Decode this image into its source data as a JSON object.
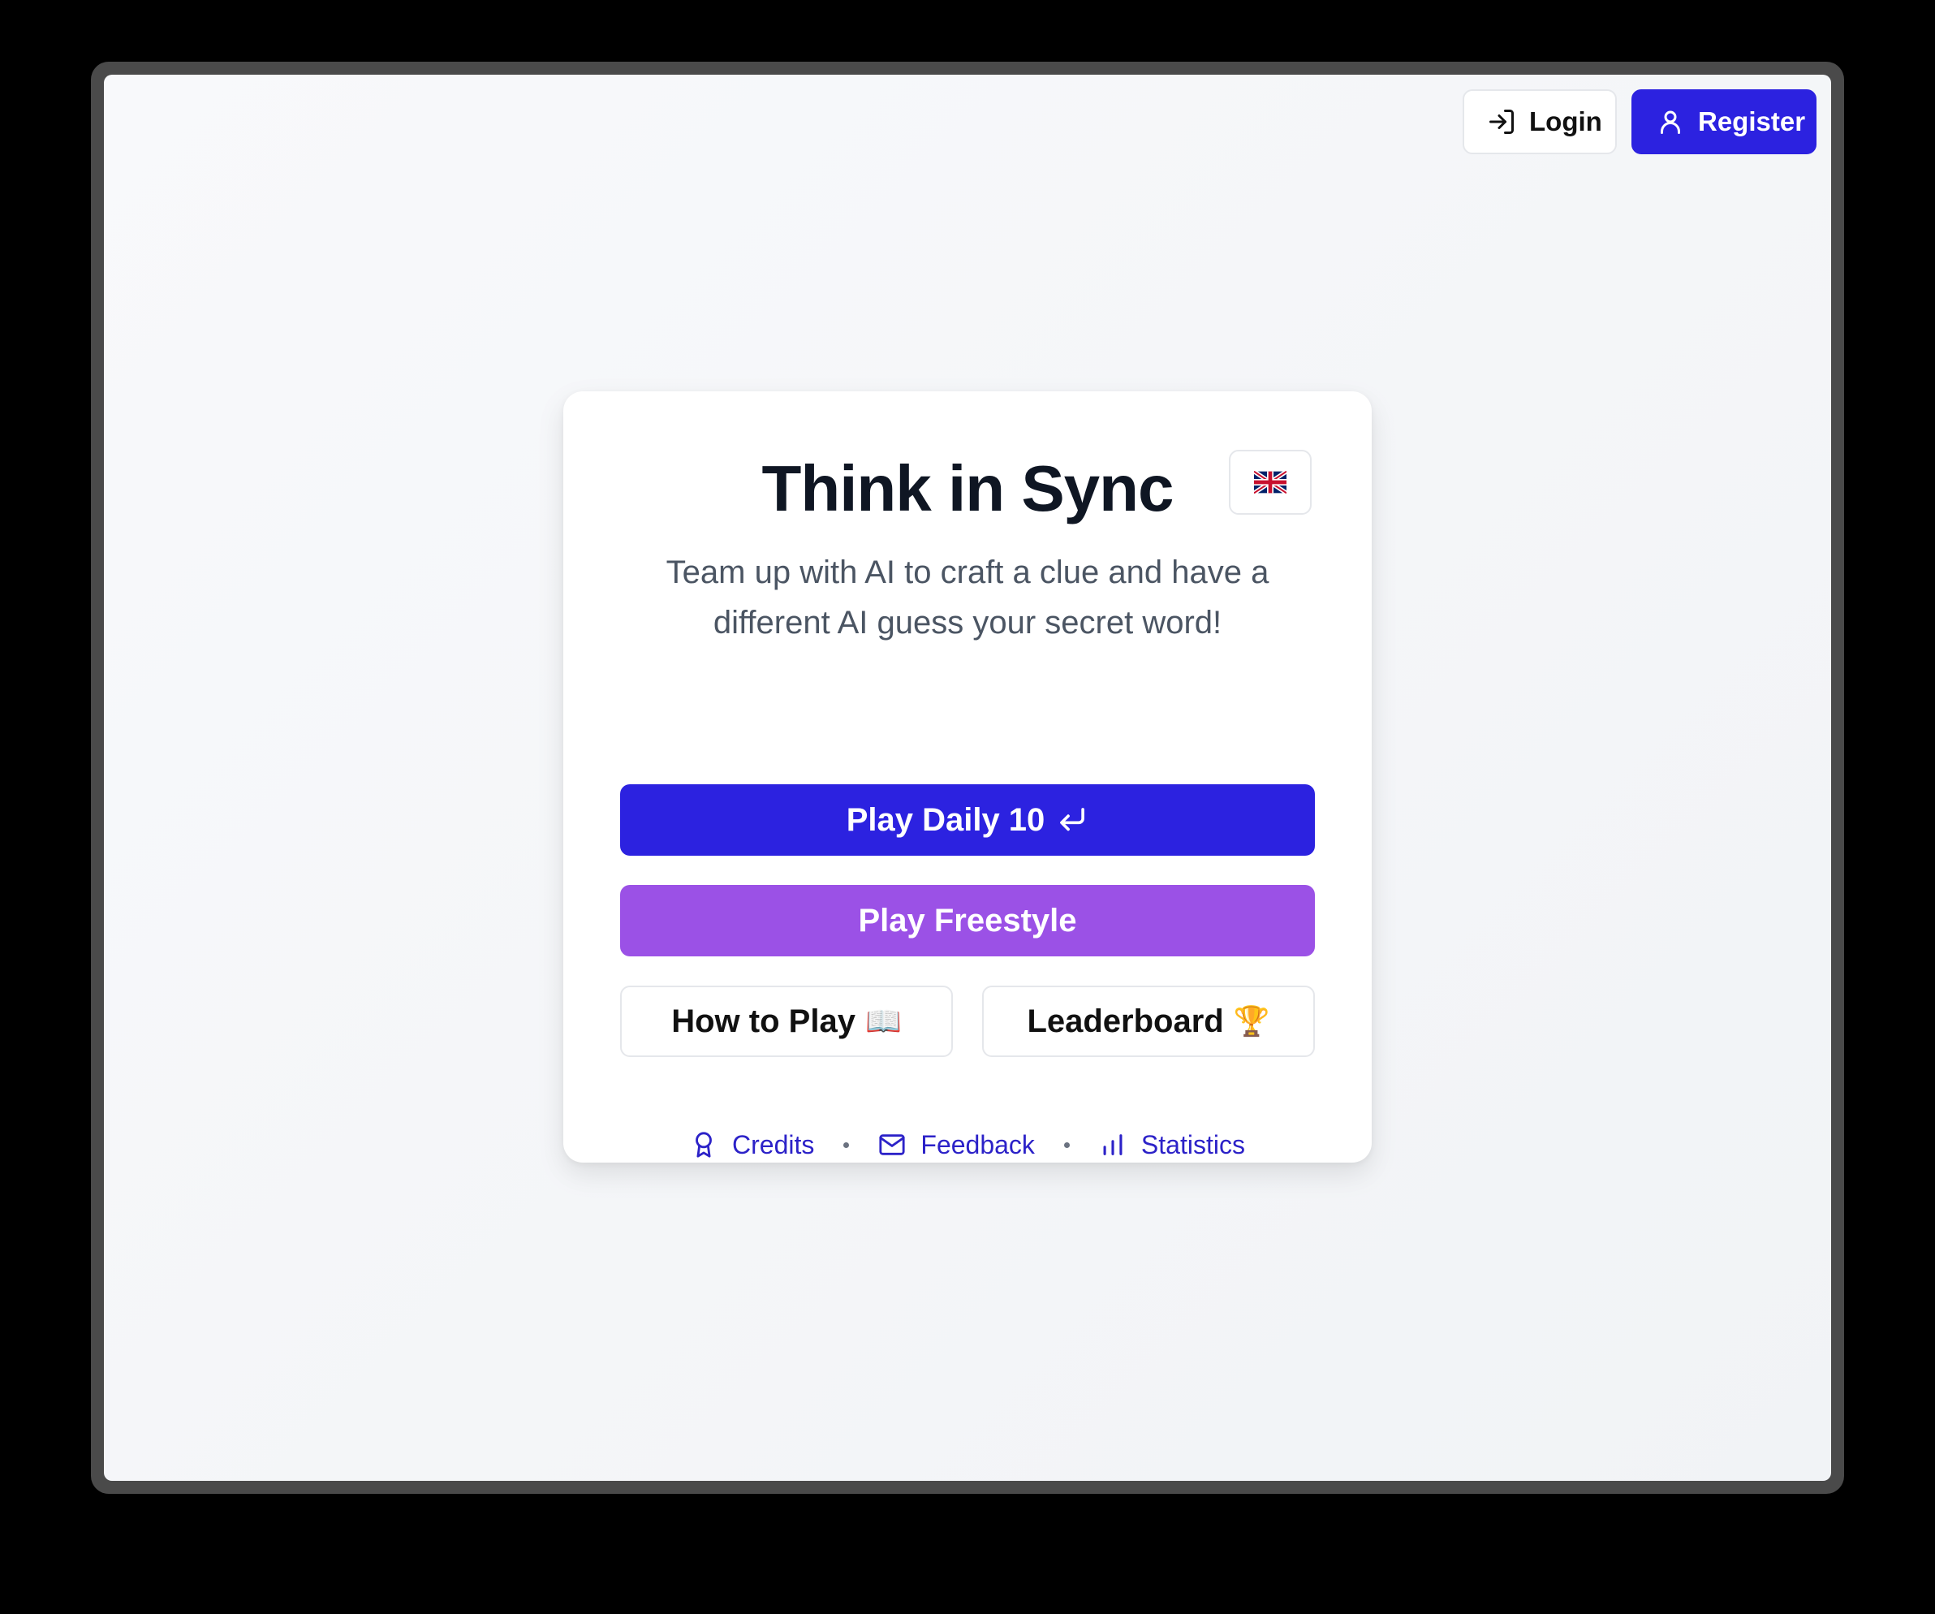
{
  "header": {
    "login_label": "Login",
    "register_label": "Register",
    "login_icon": "login-icon",
    "register_icon": "user-icon"
  },
  "card": {
    "title": "Think in Sync",
    "language_flag": "uk-flag-icon",
    "subtitle": "Team up with AI to craft a clue and have a different AI guess your secret word!",
    "play_daily_label": "Play Daily 10",
    "play_daily_icon": "enter-key-icon",
    "play_freestyle_label": "Play Freestyle",
    "how_to_play_label": "How to Play",
    "how_to_play_emoji": "📖",
    "leaderboard_label": "Leaderboard",
    "leaderboard_emoji": "🏆"
  },
  "footer_links": [
    {
      "label": "Credits",
      "icon": "award-icon"
    },
    {
      "label": "Feedback",
      "icon": "mail-icon"
    },
    {
      "label": "Statistics",
      "icon": "bar-chart-icon"
    }
  ],
  "colors": {
    "primary": "#2c22e0",
    "freestyle": "#9b51e6",
    "title": "#0f1623",
    "subtitle": "#4b5563",
    "link": "#2c22c8"
  }
}
